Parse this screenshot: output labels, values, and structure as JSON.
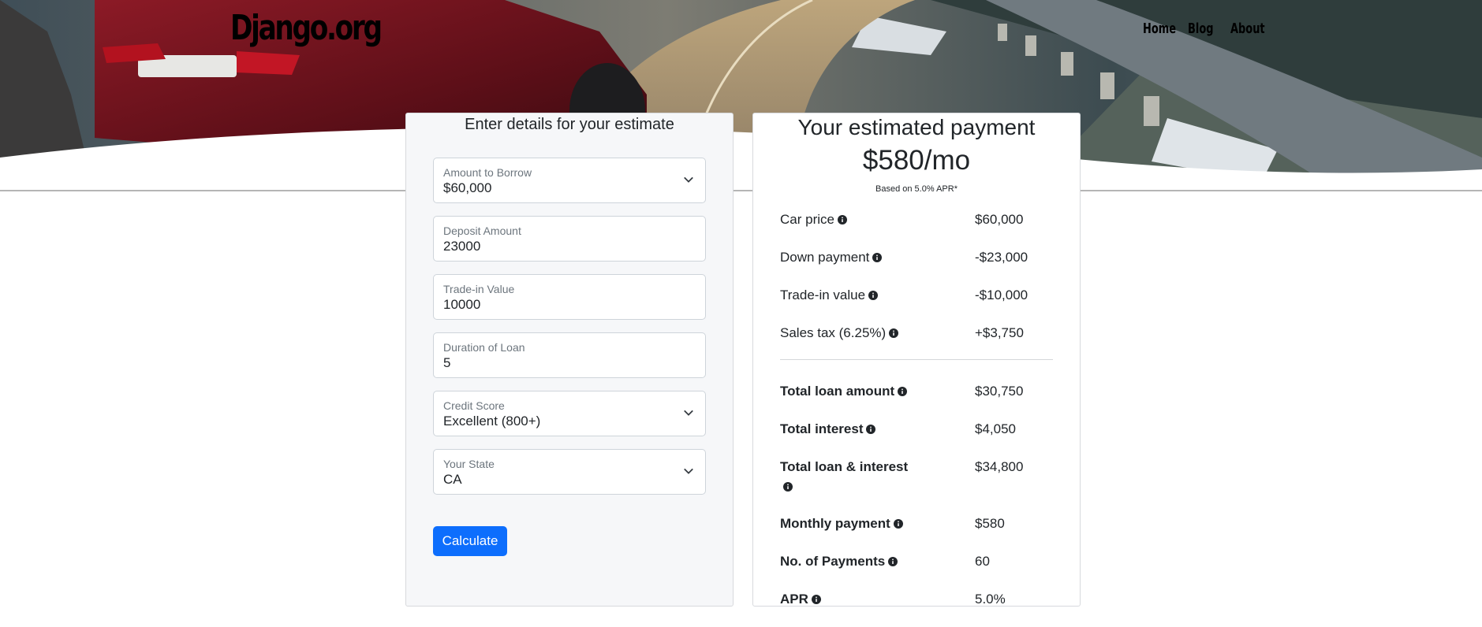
{
  "header": {
    "brand": "Django.org",
    "nav": [
      "Home",
      "Blog",
      "About"
    ]
  },
  "form": {
    "title": "Enter details for your estimate",
    "fields": [
      {
        "label": "Amount to Borrow",
        "value": "$60,000",
        "type": "select"
      },
      {
        "label": "Deposit Amount",
        "value": "23000",
        "type": "input"
      },
      {
        "label": "Trade-in Value",
        "value": "10000",
        "type": "input"
      },
      {
        "label": "Duration of Loan",
        "value": "5",
        "type": "input"
      },
      {
        "label": "Credit Score",
        "value": "Excellent (800+)",
        "type": "select"
      },
      {
        "label": "Your State",
        "value": "CA",
        "type": "select"
      }
    ],
    "button": "Calculate",
    "button_color": "#0d6efd"
  },
  "estimate": {
    "title": "Your estimated payment",
    "amount": "$580/mo",
    "apr_note": "Based on 5.0% APR*",
    "rows": [
      {
        "label": "Car price",
        "value": "$60,000",
        "bold": false
      },
      {
        "label": "Down payment",
        "value": "-$23,000",
        "bold": false
      },
      {
        "label": "Trade-in value",
        "value": "-$10,000",
        "bold": false
      },
      {
        "label": "Sales tax (6.25%)",
        "value": "+$3,750",
        "bold": false
      },
      {
        "label": "Total loan amount",
        "value": "$30,750",
        "bold": true
      },
      {
        "label": "Total interest",
        "value": "$4,050",
        "bold": true
      },
      {
        "label": "Total loan & interest",
        "value": "$34,800",
        "bold": true
      },
      {
        "label": "Monthly payment",
        "value": "$580",
        "bold": true
      },
      {
        "label": "No. of Payments",
        "value": "60",
        "bold": true
      },
      {
        "label": "APR",
        "value": "5.0%",
        "bold": true
      }
    ]
  },
  "icons": {
    "info": "info-circle-icon",
    "chevron": "chevron-down-icon"
  }
}
